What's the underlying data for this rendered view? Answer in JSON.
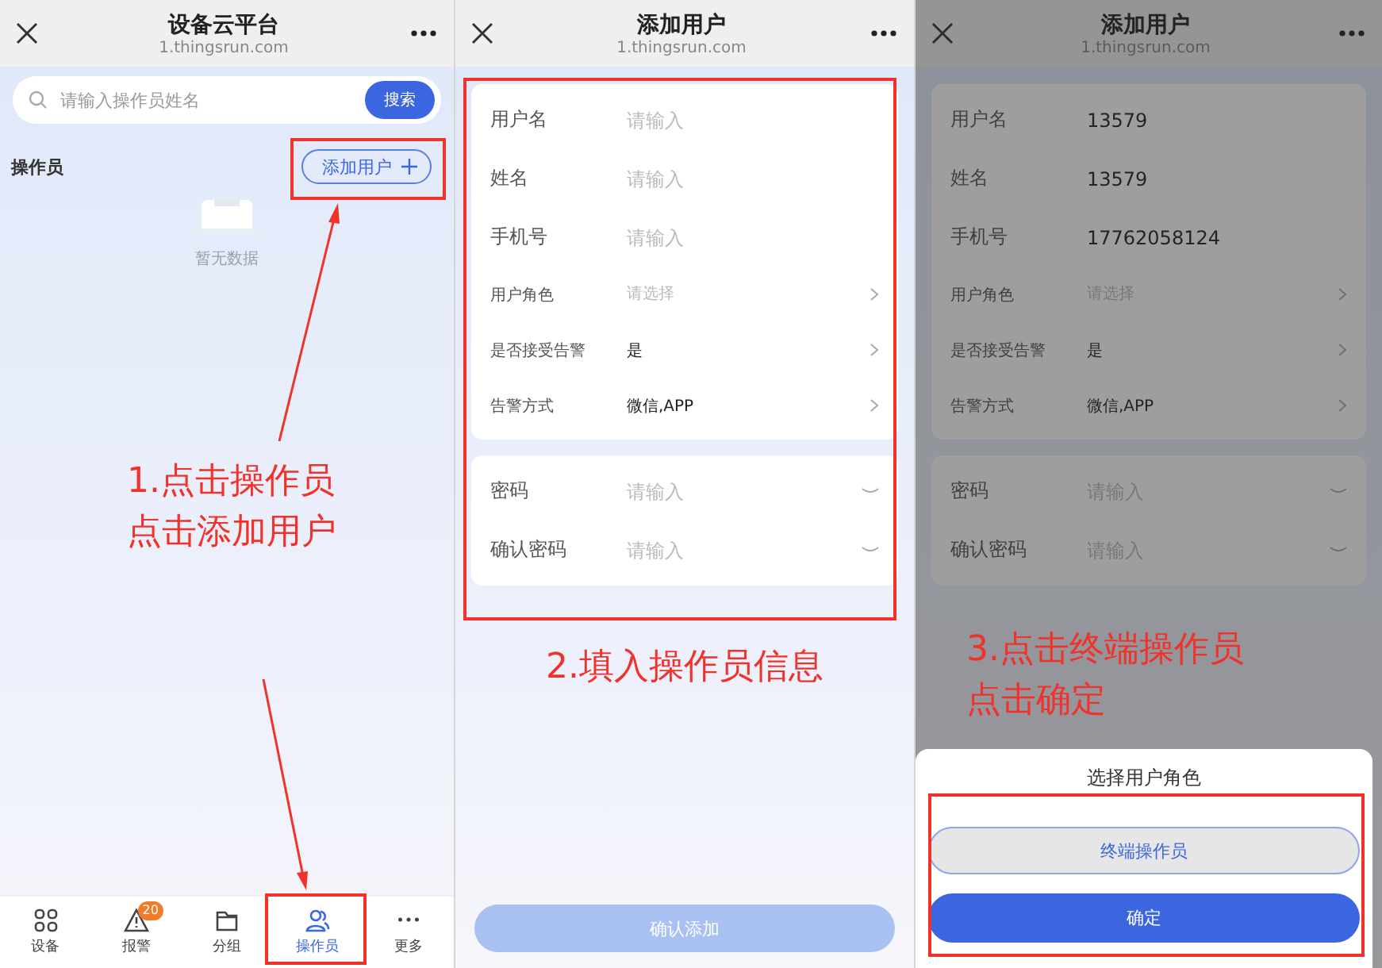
{
  "step_1": {
    "header": {
      "title": "设备云平台",
      "url": "1.thingsrun.com"
    },
    "search": {
      "placeholder": "请输入操作员姓名",
      "button": "搜索"
    },
    "section_title": "操作员",
    "add_button": "添加用户",
    "empty_text": "暂无数据",
    "annotation": [
      "1.点击操作员",
      "点击添加用户"
    ],
    "tabs": [
      {
        "label": "设备",
        "selected": false
      },
      {
        "label": "报警",
        "selected": false,
        "badge": "20"
      },
      {
        "label": "分组",
        "selected": false
      },
      {
        "label": "操作员",
        "selected": true
      },
      {
        "label": "更多",
        "selected": false
      }
    ]
  },
  "step_2": {
    "header": {
      "title": "添加用户",
      "url": "1.thingsrun.com"
    },
    "form": [
      [
        {
          "label": "用户名",
          "kind": "text",
          "placeholder": "请输入"
        },
        {
          "label": "姓名",
          "kind": "text",
          "placeholder": "请输入"
        },
        {
          "label": "手机号",
          "kind": "text",
          "placeholder": "请输入"
        },
        {
          "label": "用户角色",
          "kind": "select",
          "placeholder": "请选择"
        },
        {
          "label": "是否接受告警",
          "kind": "select",
          "value": "是"
        },
        {
          "label": "告警方式",
          "kind": "select",
          "value": "微信,APP"
        }
      ],
      [
        {
          "label": "密码",
          "kind": "password",
          "placeholder": "请输入"
        },
        {
          "label": "确认密码",
          "kind": "password",
          "placeholder": "请输入"
        }
      ]
    ],
    "annotation": [
      "2.填入操作员信息"
    ],
    "submit_button": {
      "label": "确认添加",
      "disabled": true
    }
  },
  "step_3": {
    "header": {
      "title": "添加用户",
      "url": "1.thingsrun.com"
    },
    "form": [
      [
        {
          "label": "用户名",
          "kind": "text",
          "value": "13579"
        },
        {
          "label": "姓名",
          "kind": "text",
          "value": "13579"
        },
        {
          "label": "手机号",
          "kind": "text",
          "value": "17762058124"
        },
        {
          "label": "用户角色",
          "kind": "select",
          "placeholder": "请选择"
        },
        {
          "label": "是否接受告警",
          "kind": "select",
          "value": "是"
        },
        {
          "label": "告警方式",
          "kind": "select",
          "value": "微信,APP"
        }
      ],
      [
        {
          "label": "密码",
          "kind": "password",
          "placeholder": "请输入"
        },
        {
          "label": "确认密码",
          "kind": "password",
          "placeholder": "请输入"
        }
      ]
    ],
    "annotation": [
      "3.点击终端操作员",
      "点击确定"
    ],
    "sheet": {
      "title": "选择用户角色",
      "options": [
        {
          "label": "终端操作员",
          "selected": true
        }
      ],
      "confirm": "确定"
    }
  }
}
